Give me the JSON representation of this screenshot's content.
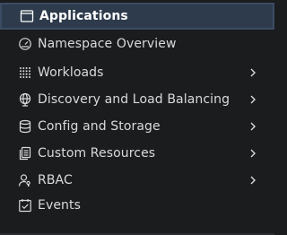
{
  "menu": {
    "items": [
      {
        "label": "Applications",
        "icon": "applications-window-icon",
        "active": true,
        "expandable": false
      },
      {
        "label": "Namespace Overview",
        "icon": "dashboard-gauge-icon",
        "active": false,
        "expandable": false
      },
      {
        "label": "Workloads",
        "icon": "workloads-grid-icon",
        "active": false,
        "expandable": true
      },
      {
        "label": "Discovery and Load Balancing",
        "icon": "globe-network-icon",
        "active": false,
        "expandable": true
      },
      {
        "label": "Config and Storage",
        "icon": "database-icon",
        "active": false,
        "expandable": true
      },
      {
        "label": "Custom Resources",
        "icon": "documents-stack-icon",
        "active": false,
        "expandable": true
      },
      {
        "label": "RBAC",
        "icon": "user-key-icon",
        "active": false,
        "expandable": true
      },
      {
        "label": "Events",
        "icon": "calendar-check-icon",
        "active": false,
        "expandable": false
      }
    ]
  },
  "colors": {
    "background": "#1b1c1e",
    "active_background": "#2e3b4c",
    "text": "#d8dadc",
    "active_text": "#ffffff"
  }
}
